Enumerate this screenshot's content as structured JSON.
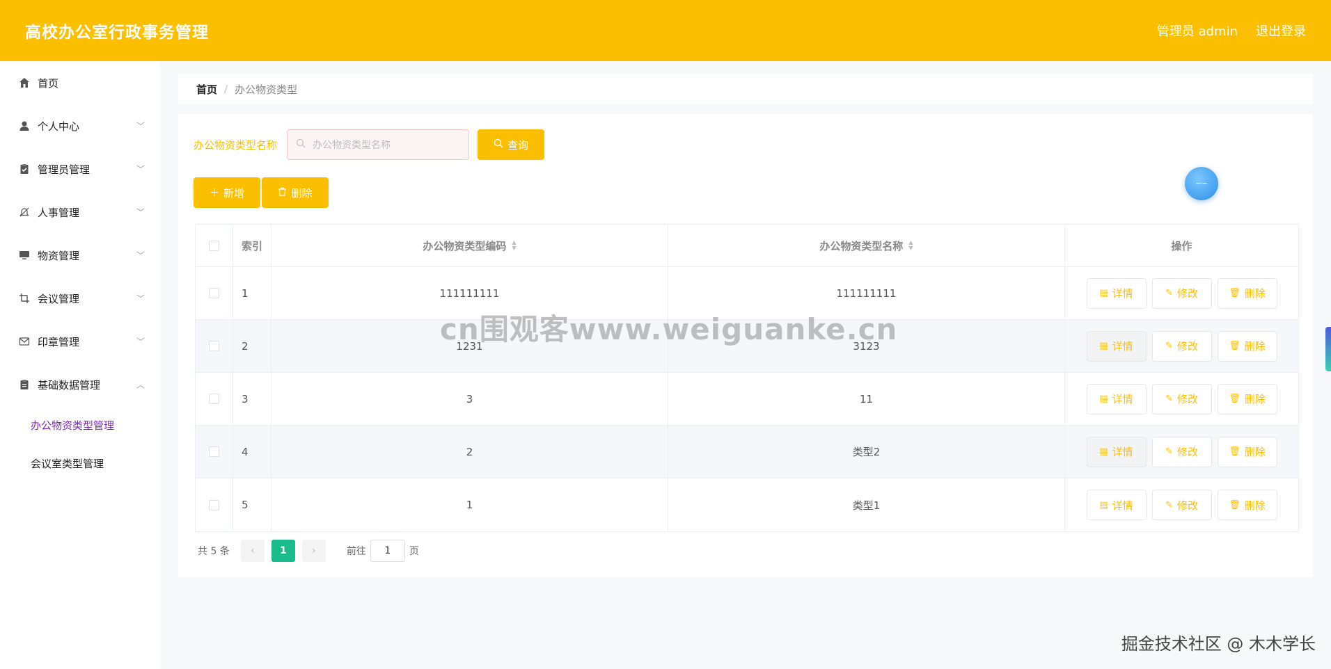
{
  "header": {
    "title": "高校办公室行政事务管理",
    "user": "管理员 admin",
    "logout": "退出登录"
  },
  "sidebar": {
    "items": [
      {
        "label": "首页",
        "icon": "home-icon"
      },
      {
        "label": "个人中心",
        "icon": "user-icon"
      },
      {
        "label": "管理员管理",
        "icon": "clipboard-check-icon"
      },
      {
        "label": "人事管理",
        "icon": "bell-off-icon"
      },
      {
        "label": "物资管理",
        "icon": "monitor-icon"
      },
      {
        "label": "会议管理",
        "icon": "crop-icon"
      },
      {
        "label": "印章管理",
        "icon": "mail-icon"
      },
      {
        "label": "基础数据管理",
        "icon": "clipboard-icon"
      }
    ],
    "sub_items": [
      {
        "label": "办公物资类型管理",
        "active": true
      },
      {
        "label": "会议室类型管理",
        "active": false
      }
    ]
  },
  "breadcrumb": {
    "home": "首页",
    "separator": "/",
    "current": "办公物资类型"
  },
  "search": {
    "label": "办公物资类型名称",
    "placeholder": "办公物资类型名称",
    "query_label": "查询"
  },
  "actions": {
    "add_label": "新增",
    "delete_label": "删除"
  },
  "table": {
    "headers": {
      "index": "索引",
      "code": "办公物资类型编码",
      "name": "办公物资类型名称",
      "ops": "操作"
    },
    "rows": [
      {
        "index": "1",
        "code": "111111111",
        "name": "111111111"
      },
      {
        "index": "2",
        "code": "1231",
        "name": "3123"
      },
      {
        "index": "3",
        "code": "3",
        "name": "11"
      },
      {
        "index": "4",
        "code": "2",
        "name": "类型2"
      },
      {
        "index": "5",
        "code": "1",
        "name": "类型1"
      }
    ],
    "op_labels": {
      "detail": "详情",
      "edit": "修改",
      "delete": "删除"
    }
  },
  "pagination": {
    "total": "共 5 条",
    "prev": "‹",
    "current": "1",
    "next": "›",
    "goto_prefix": "前往",
    "goto_value": "1",
    "goto_suffix": "页"
  },
  "watermark": "cn围观客www.weiguanke.cn",
  "footer_mark": "掘金技术社区 @ 木木学长",
  "colors": {
    "accent": "#fcbf00",
    "active_menu": "#7a29b8",
    "pager_current": "#1abc8c"
  }
}
